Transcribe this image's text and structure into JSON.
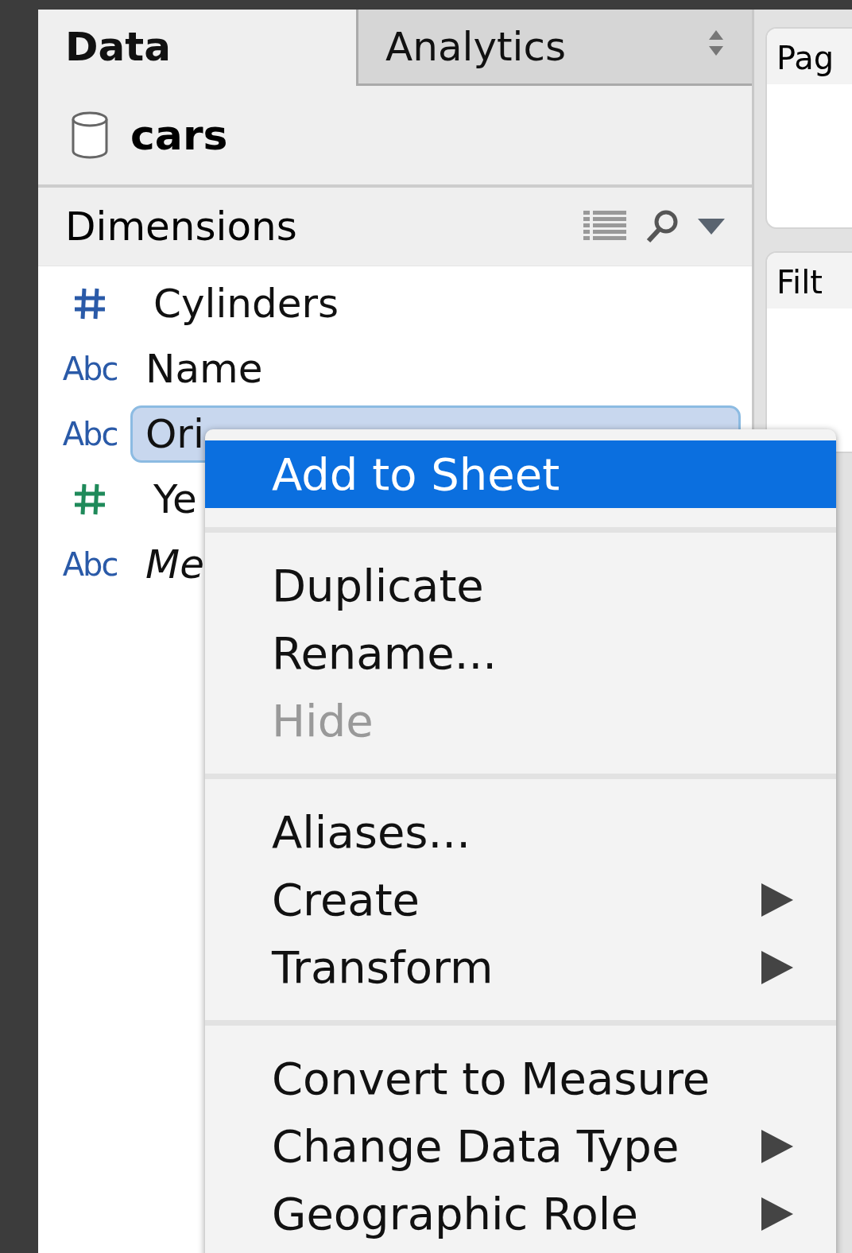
{
  "tabs": [
    {
      "label": "Data",
      "selected": true
    },
    {
      "label": "Analytics",
      "selected": false
    }
  ],
  "data_source": {
    "name": "cars"
  },
  "dimensions": {
    "title": "Dimensions",
    "fields": [
      {
        "kind": "number",
        "name": "Cylinders",
        "color": "#2a5aa8",
        "selected": false,
        "italic": false
      },
      {
        "kind": "text",
        "type_label": "Abc",
        "name": "Name",
        "color": "#2a5aa8",
        "selected": false,
        "italic": false
      },
      {
        "kind": "text",
        "type_label": "Abc",
        "name": "Ori",
        "color": "#2a5aa8",
        "selected": true,
        "italic": false
      },
      {
        "kind": "number",
        "name": "Ye",
        "color": "#1f8a5a",
        "selected": false,
        "italic": false
      },
      {
        "kind": "text",
        "type_label": "Abc",
        "name": "Me",
        "color": "#2a5aa8",
        "selected": false,
        "italic": true
      }
    ]
  },
  "shelves": [
    {
      "title": "Pag"
    },
    {
      "title": "Filt"
    }
  ],
  "context_menu": [
    {
      "kind": "item",
      "label": "Add to Sheet",
      "selected": true,
      "disabled": false,
      "submenu": false
    },
    {
      "kind": "separator"
    },
    {
      "kind": "item",
      "label": "Duplicate",
      "selected": false,
      "disabled": false,
      "submenu": false
    },
    {
      "kind": "item",
      "label": "Rename...",
      "selected": false,
      "disabled": false,
      "submenu": false
    },
    {
      "kind": "item",
      "label": "Hide",
      "selected": false,
      "disabled": true,
      "submenu": false
    },
    {
      "kind": "separator"
    },
    {
      "kind": "item",
      "label": "Aliases...",
      "selected": false,
      "disabled": false,
      "submenu": false
    },
    {
      "kind": "item",
      "label": "Create",
      "selected": false,
      "disabled": false,
      "submenu": true
    },
    {
      "kind": "item",
      "label": "Transform",
      "selected": false,
      "disabled": false,
      "submenu": true
    },
    {
      "kind": "separator"
    },
    {
      "kind": "item",
      "label": "Convert to Measure",
      "selected": false,
      "disabled": false,
      "submenu": false
    },
    {
      "kind": "item",
      "label": "Change Data Type",
      "selected": false,
      "disabled": false,
      "submenu": true
    },
    {
      "kind": "item",
      "label": "Geographic Role",
      "selected": false,
      "disabled": false,
      "submenu": true
    }
  ]
}
